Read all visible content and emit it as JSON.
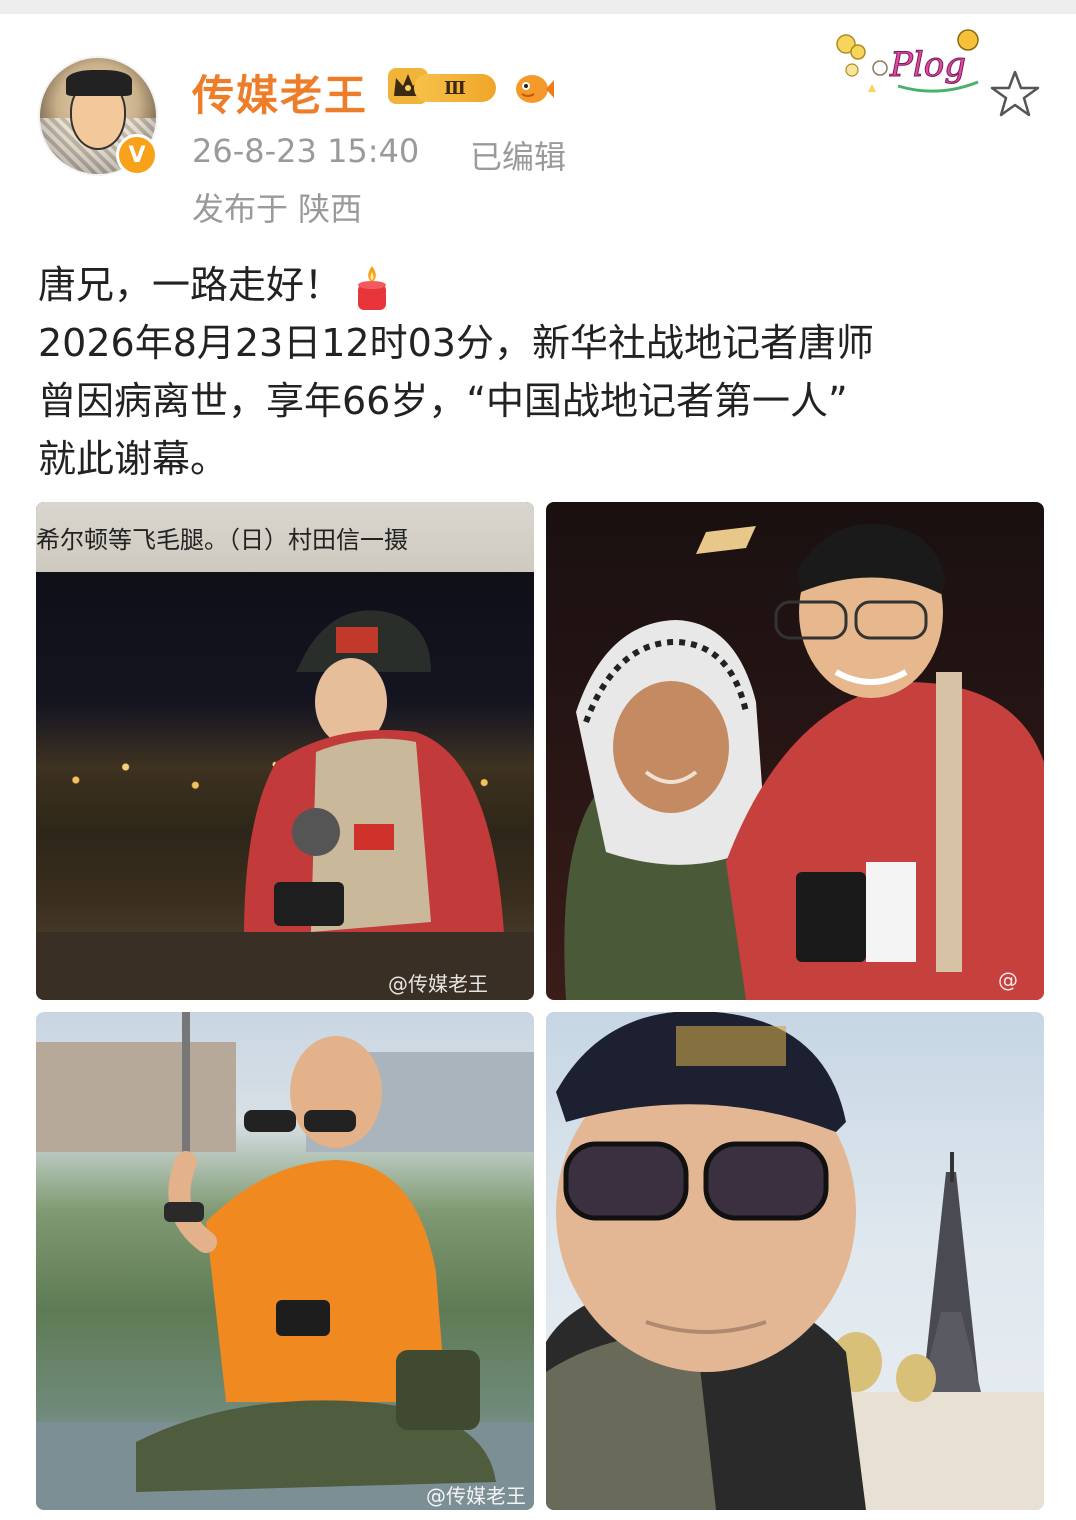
{
  "post": {
    "username": "传媒老王",
    "level_badge": "Ⅲ",
    "time": "26-8-23 15:40",
    "edited": "已编辑",
    "location": "发布于 陕西",
    "text_lines": [
      "唐兄，一路走好！",
      "2026年8月23日12时03分，新华社战地记者唐师",
      "曾因病离世，享年66岁，“中国战地记者第一人”",
      "就此谢幕。"
    ],
    "sticker": "Plog"
  },
  "photos": [
    {
      "caption": "希尔顿等飞毛腿。（日）村田信一摄",
      "watermark": "@传媒老王"
    },
    {
      "watermark": "@"
    },
    {
      "watermark": "@传媒老王"
    },
    {}
  ],
  "icons": {
    "avatar_badge": "V",
    "star": "star-icon",
    "candle": "candle-icon",
    "crown": "crown-icon",
    "fish": "fish-icon"
  },
  "colors": {
    "username": "#ee7d29",
    "meta": "#9a9a9a",
    "badge": "#f7a21a"
  }
}
